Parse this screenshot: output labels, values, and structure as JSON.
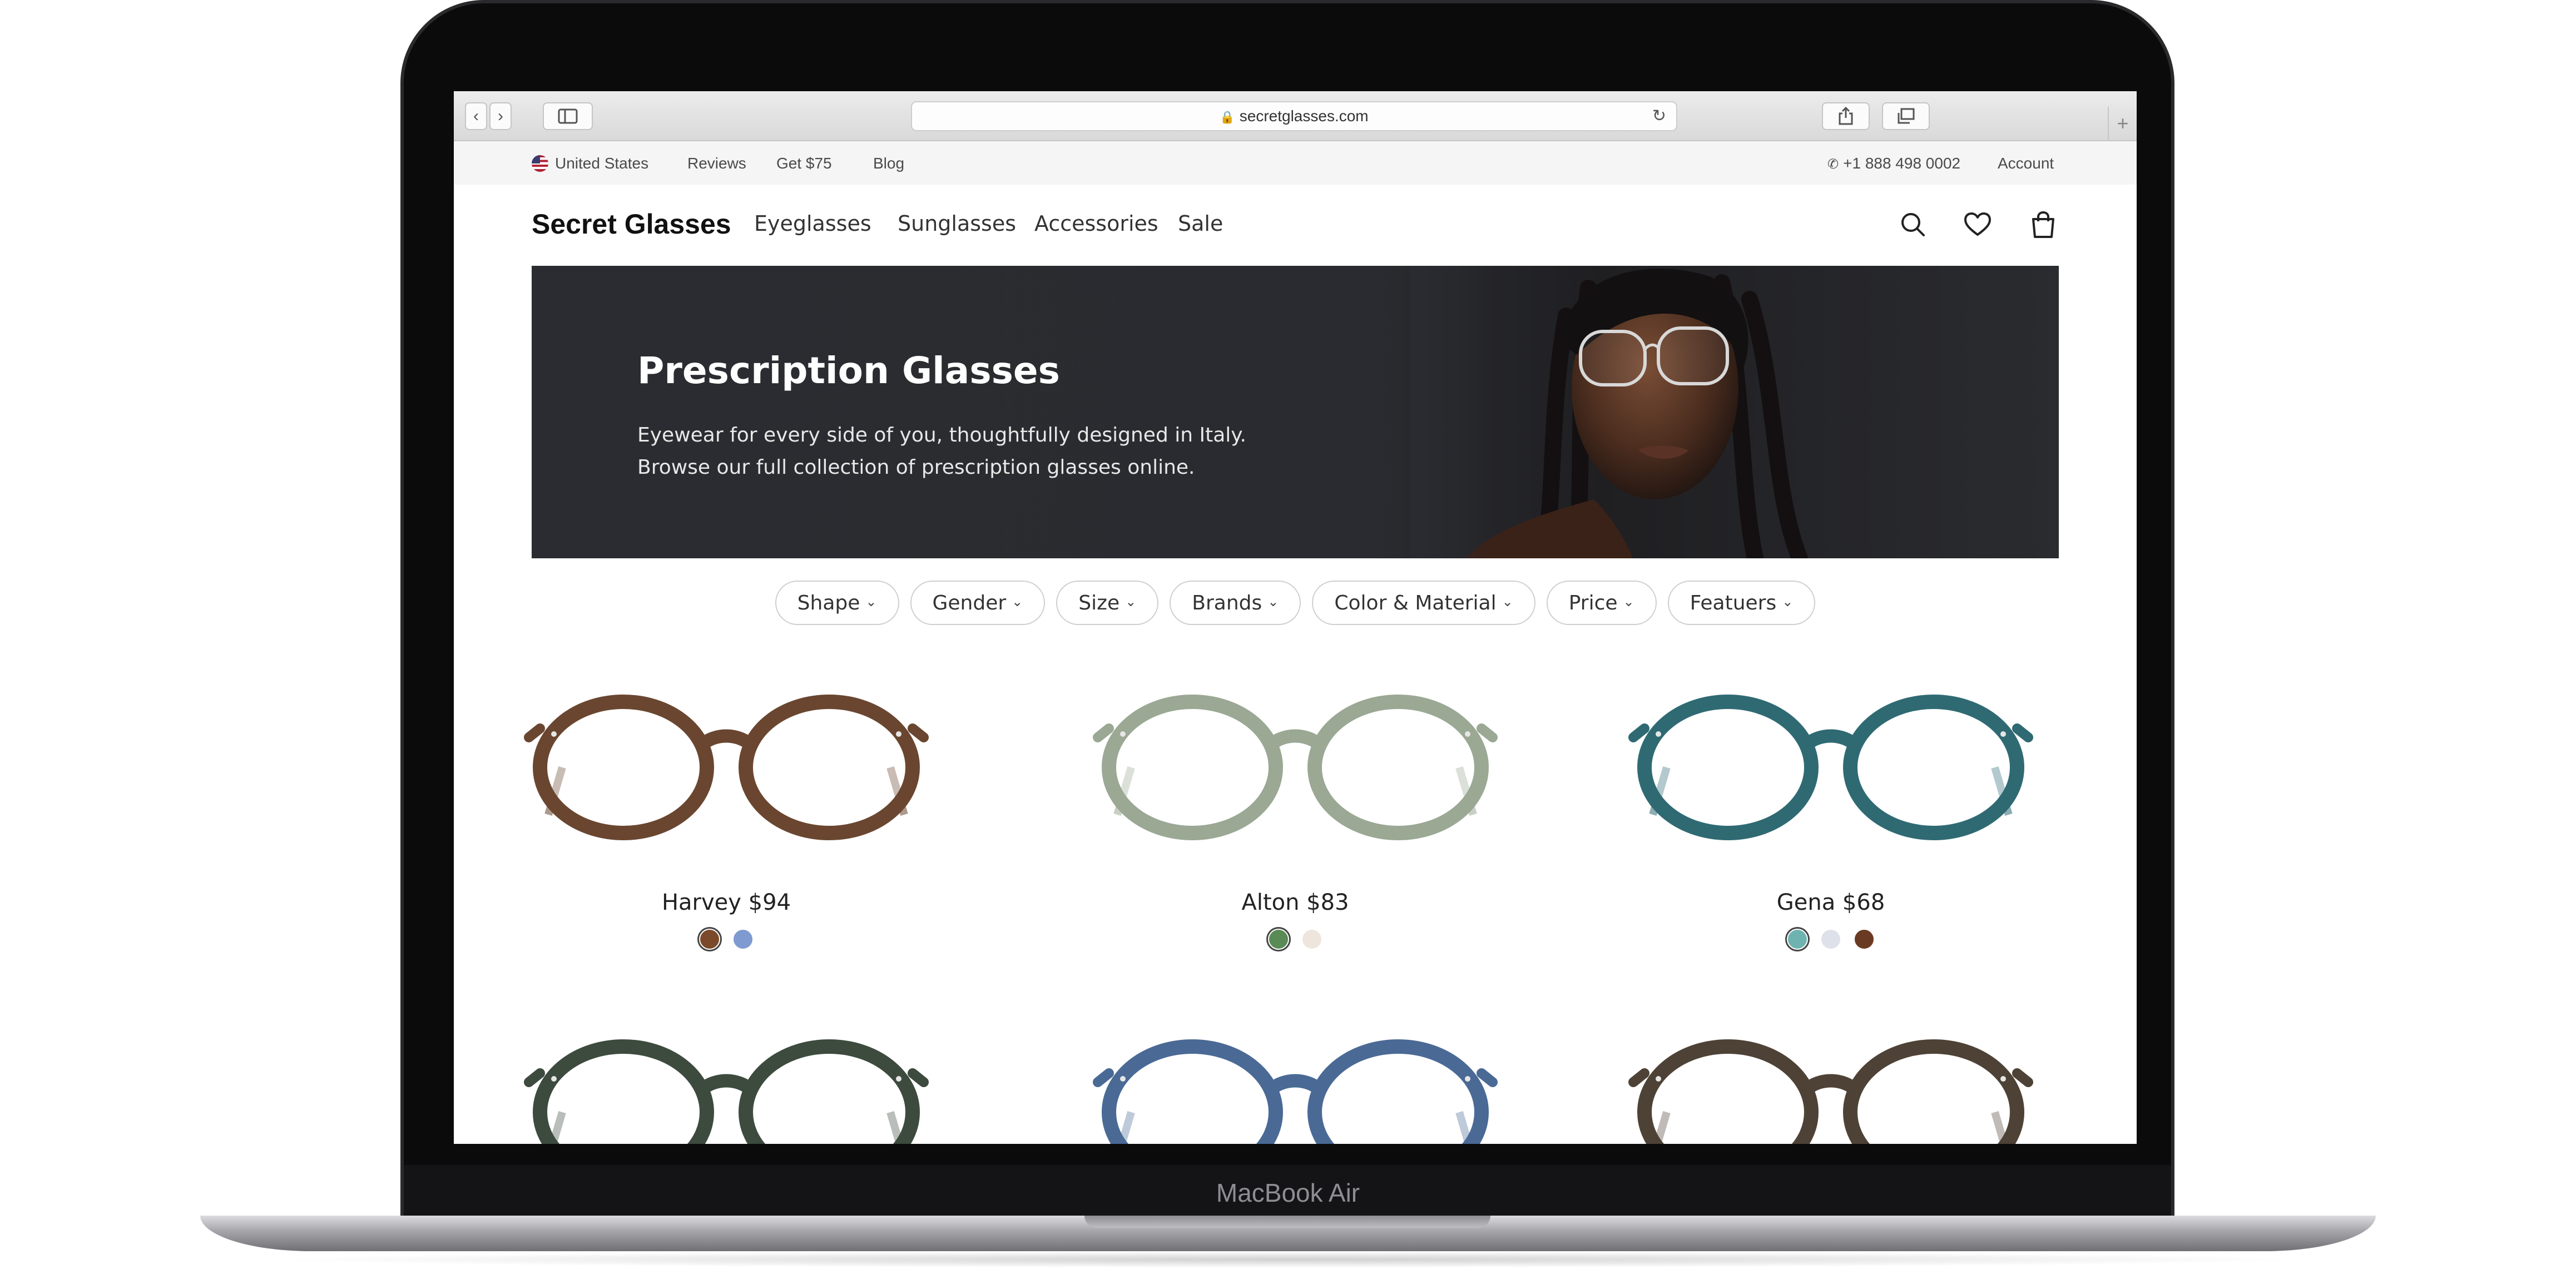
{
  "device": {
    "label": "MacBook Air"
  },
  "browser": {
    "url": "secretglasses.com",
    "icons": {
      "back": "chevron-left-icon",
      "forward": "chevron-right-icon",
      "sidebar": "sidebar-icon",
      "lock": "lock-icon",
      "reload": "reload-icon",
      "share": "share-icon",
      "tabs": "tabs-icon",
      "new_tab": "plus-icon"
    }
  },
  "utility_bar": {
    "country": "United States",
    "links": [
      "Reviews",
      "Get $75",
      "Blog"
    ],
    "phone": "+1 888 498 0002",
    "account": "Account"
  },
  "header": {
    "logo": "Secret Glasses",
    "nav": [
      "Eyeglasses",
      "Sunglasses",
      "Accessories",
      "Sale"
    ],
    "icons": [
      "search-icon",
      "heart-icon",
      "bag-icon"
    ]
  },
  "hero": {
    "title": "Prescription Glasses",
    "line1": "Eyewear for every side of you, thoughtfully designed in Italy.",
    "line2": "Browse our full collection of prescription glasses online."
  },
  "filters": [
    "Shape",
    "Gender",
    "Size",
    "Brands",
    "Color & Material",
    "Price",
    "Featuers"
  ],
  "products": [
    {
      "name": "Harvey $94",
      "frame_color": "#6a4630",
      "swatches": [
        "#7a4a2a",
        "#7f9ad0"
      ],
      "selected": 0
    },
    {
      "name": "Alton $83",
      "frame_color": "#9aa894",
      "swatches": [
        "#5a8a55",
        "#eee6dc"
      ],
      "selected": 0
    },
    {
      "name": "Gena $68",
      "frame_color": "#2f6a73",
      "swatches": [
        "#6fb3b0",
        "#dfe1ea",
        "#6a3a22"
      ],
      "selected": 0
    },
    {
      "name": "",
      "frame_color": "#3d4a3e",
      "swatches": [],
      "selected": -1
    },
    {
      "name": "",
      "frame_color": "#4a6a95",
      "swatches": [],
      "selected": -1
    },
    {
      "name": "",
      "frame_color": "#4e4236",
      "swatches": [],
      "selected": -1
    }
  ]
}
